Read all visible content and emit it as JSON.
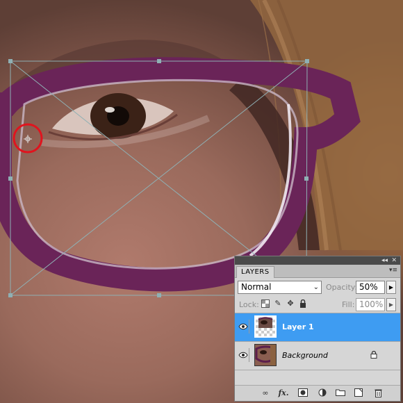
{
  "panel": {
    "tab_label": "LAYERS",
    "collapse_glyph": "◂◂",
    "close_glyph": "✕",
    "menu_glyph": "▾≡",
    "blend_mode": "Normal",
    "opacity_label": "Opacity:",
    "opacity_value": "50%",
    "lock_label": "Lock:",
    "fill_label": "Fill:",
    "fill_value": "100%",
    "layers": [
      {
        "name": "Layer 1",
        "visible": true,
        "selected": true,
        "locked": false
      },
      {
        "name": "Background",
        "visible": true,
        "selected": false,
        "locked": true
      }
    ],
    "bottom_icons": [
      "link-icon",
      "fx-icon",
      "mask-icon",
      "adjustment-icon",
      "group-icon",
      "new-layer-icon",
      "trash-icon"
    ],
    "fx_text": "fx.",
    "selection_color": "#3e9cf2"
  },
  "canvas": {
    "subject": "close-up photo of eye with purple glasses",
    "frame_color": "#6a2458",
    "transform_handle_color": "#8fb0b4",
    "marker_color": "#e0141e"
  }
}
